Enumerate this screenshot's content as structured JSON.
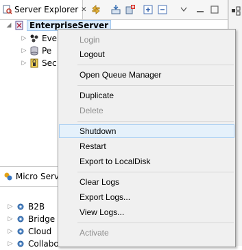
{
  "server_explorer": {
    "tab_title": "Server Explorer",
    "tab_close": "✕",
    "tree": {
      "root": "EnterpriseServer",
      "children": [
        "Eve",
        "Pe",
        "Sec"
      ]
    }
  },
  "micro_services": {
    "tab_title": "Micro Serv",
    "items": [
      "B2B",
      "Bridge",
      "Cloud",
      "Collaboration"
    ]
  },
  "context_menu": {
    "login": "Login",
    "logout": "Logout",
    "open_queue_manager": "Open Queue Manager",
    "duplicate": "Duplicate",
    "delete": "Delete",
    "shutdown": "Shutdown",
    "restart": "Restart",
    "export_to_localdisk": "Export to LocalDisk",
    "clear_logs": "Clear Logs",
    "export_logs": "Export Logs...",
    "view_logs": "View Logs...",
    "activate": "Activate"
  },
  "colors": {
    "selection_bg": "#dcecfc",
    "menu_hover_bg": "#e5f1fb",
    "disabled_text": "#8d8d8d"
  }
}
